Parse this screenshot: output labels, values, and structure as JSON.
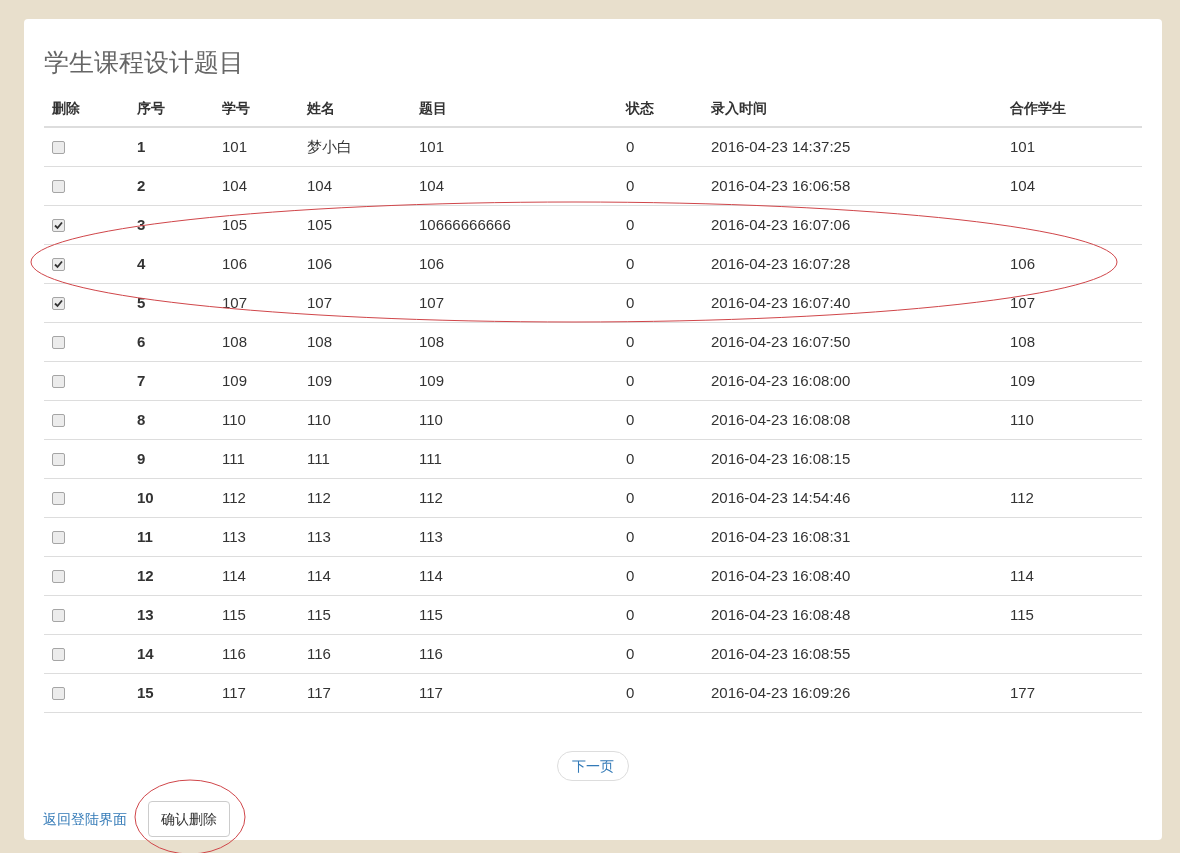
{
  "title": "学生课程设计题目",
  "table": {
    "checked_rows_circled": true,
    "columns": [
      "删除",
      "序号",
      "学号",
      "姓名",
      "题目",
      "状态",
      "录入时间",
      "合作学生"
    ],
    "rows": [
      {
        "checked": false,
        "cells": [
          "",
          "1",
          "101",
          "梦小白",
          "101",
          "0",
          "2016-04-23 14:37:25",
          "101"
        ]
      },
      {
        "checked": false,
        "cells": [
          "",
          "2",
          "104",
          "104",
          "104",
          "0",
          "2016-04-23 16:06:58",
          "104"
        ]
      },
      {
        "checked": true,
        "cells": [
          "",
          "3",
          "105",
          "105",
          "10666666666",
          "0",
          "2016-04-23 16:07:06",
          ""
        ]
      },
      {
        "checked": true,
        "cells": [
          "",
          "4",
          "106",
          "106",
          "106",
          "0",
          "2016-04-23 16:07:28",
          "106"
        ]
      },
      {
        "checked": true,
        "cells": [
          "",
          "5",
          "107",
          "107",
          "107",
          "0",
          "2016-04-23 16:07:40",
          "107"
        ]
      },
      {
        "checked": false,
        "cells": [
          "",
          "6",
          "108",
          "108",
          "108",
          "0",
          "2016-04-23 16:07:50",
          "108"
        ]
      },
      {
        "checked": false,
        "cells": [
          "",
          "7",
          "109",
          "109",
          "109",
          "0",
          "2016-04-23 16:08:00",
          "109"
        ]
      },
      {
        "checked": false,
        "cells": [
          "",
          "8",
          "110",
          "110",
          "110",
          "0",
          "2016-04-23 16:08:08",
          "110"
        ]
      },
      {
        "checked": false,
        "cells": [
          "",
          "9",
          "111",
          "111",
          "111",
          "0",
          "2016-04-23 16:08:15",
          ""
        ]
      },
      {
        "checked": false,
        "cells": [
          "",
          "10",
          "112",
          "112",
          "112",
          "0",
          "2016-04-23 14:54:46",
          "112"
        ]
      },
      {
        "checked": false,
        "cells": [
          "",
          "11",
          "113",
          "113",
          "113",
          "0",
          "2016-04-23 16:08:31",
          ""
        ]
      },
      {
        "checked": false,
        "cells": [
          "",
          "12",
          "114",
          "114",
          "114",
          "0",
          "2016-04-23 16:08:40",
          "114"
        ]
      },
      {
        "checked": false,
        "cells": [
          "",
          "13",
          "115",
          "115",
          "115",
          "0",
          "2016-04-23 16:08:48",
          "115"
        ]
      },
      {
        "checked": false,
        "cells": [
          "",
          "14",
          "116",
          "116",
          "116",
          "0",
          "2016-04-23 16:08:55",
          ""
        ]
      },
      {
        "checked": false,
        "cells": [
          "",
          "15",
          "117",
          "117",
          "117",
          "0",
          "2016-04-23 16:09:26",
          "177"
        ]
      }
    ]
  },
  "pager": {
    "next": "下一页"
  },
  "footer": {
    "back_link": "返回登陆界面",
    "confirm_button": {
      "label": "确认删除",
      "circled": true
    }
  }
}
